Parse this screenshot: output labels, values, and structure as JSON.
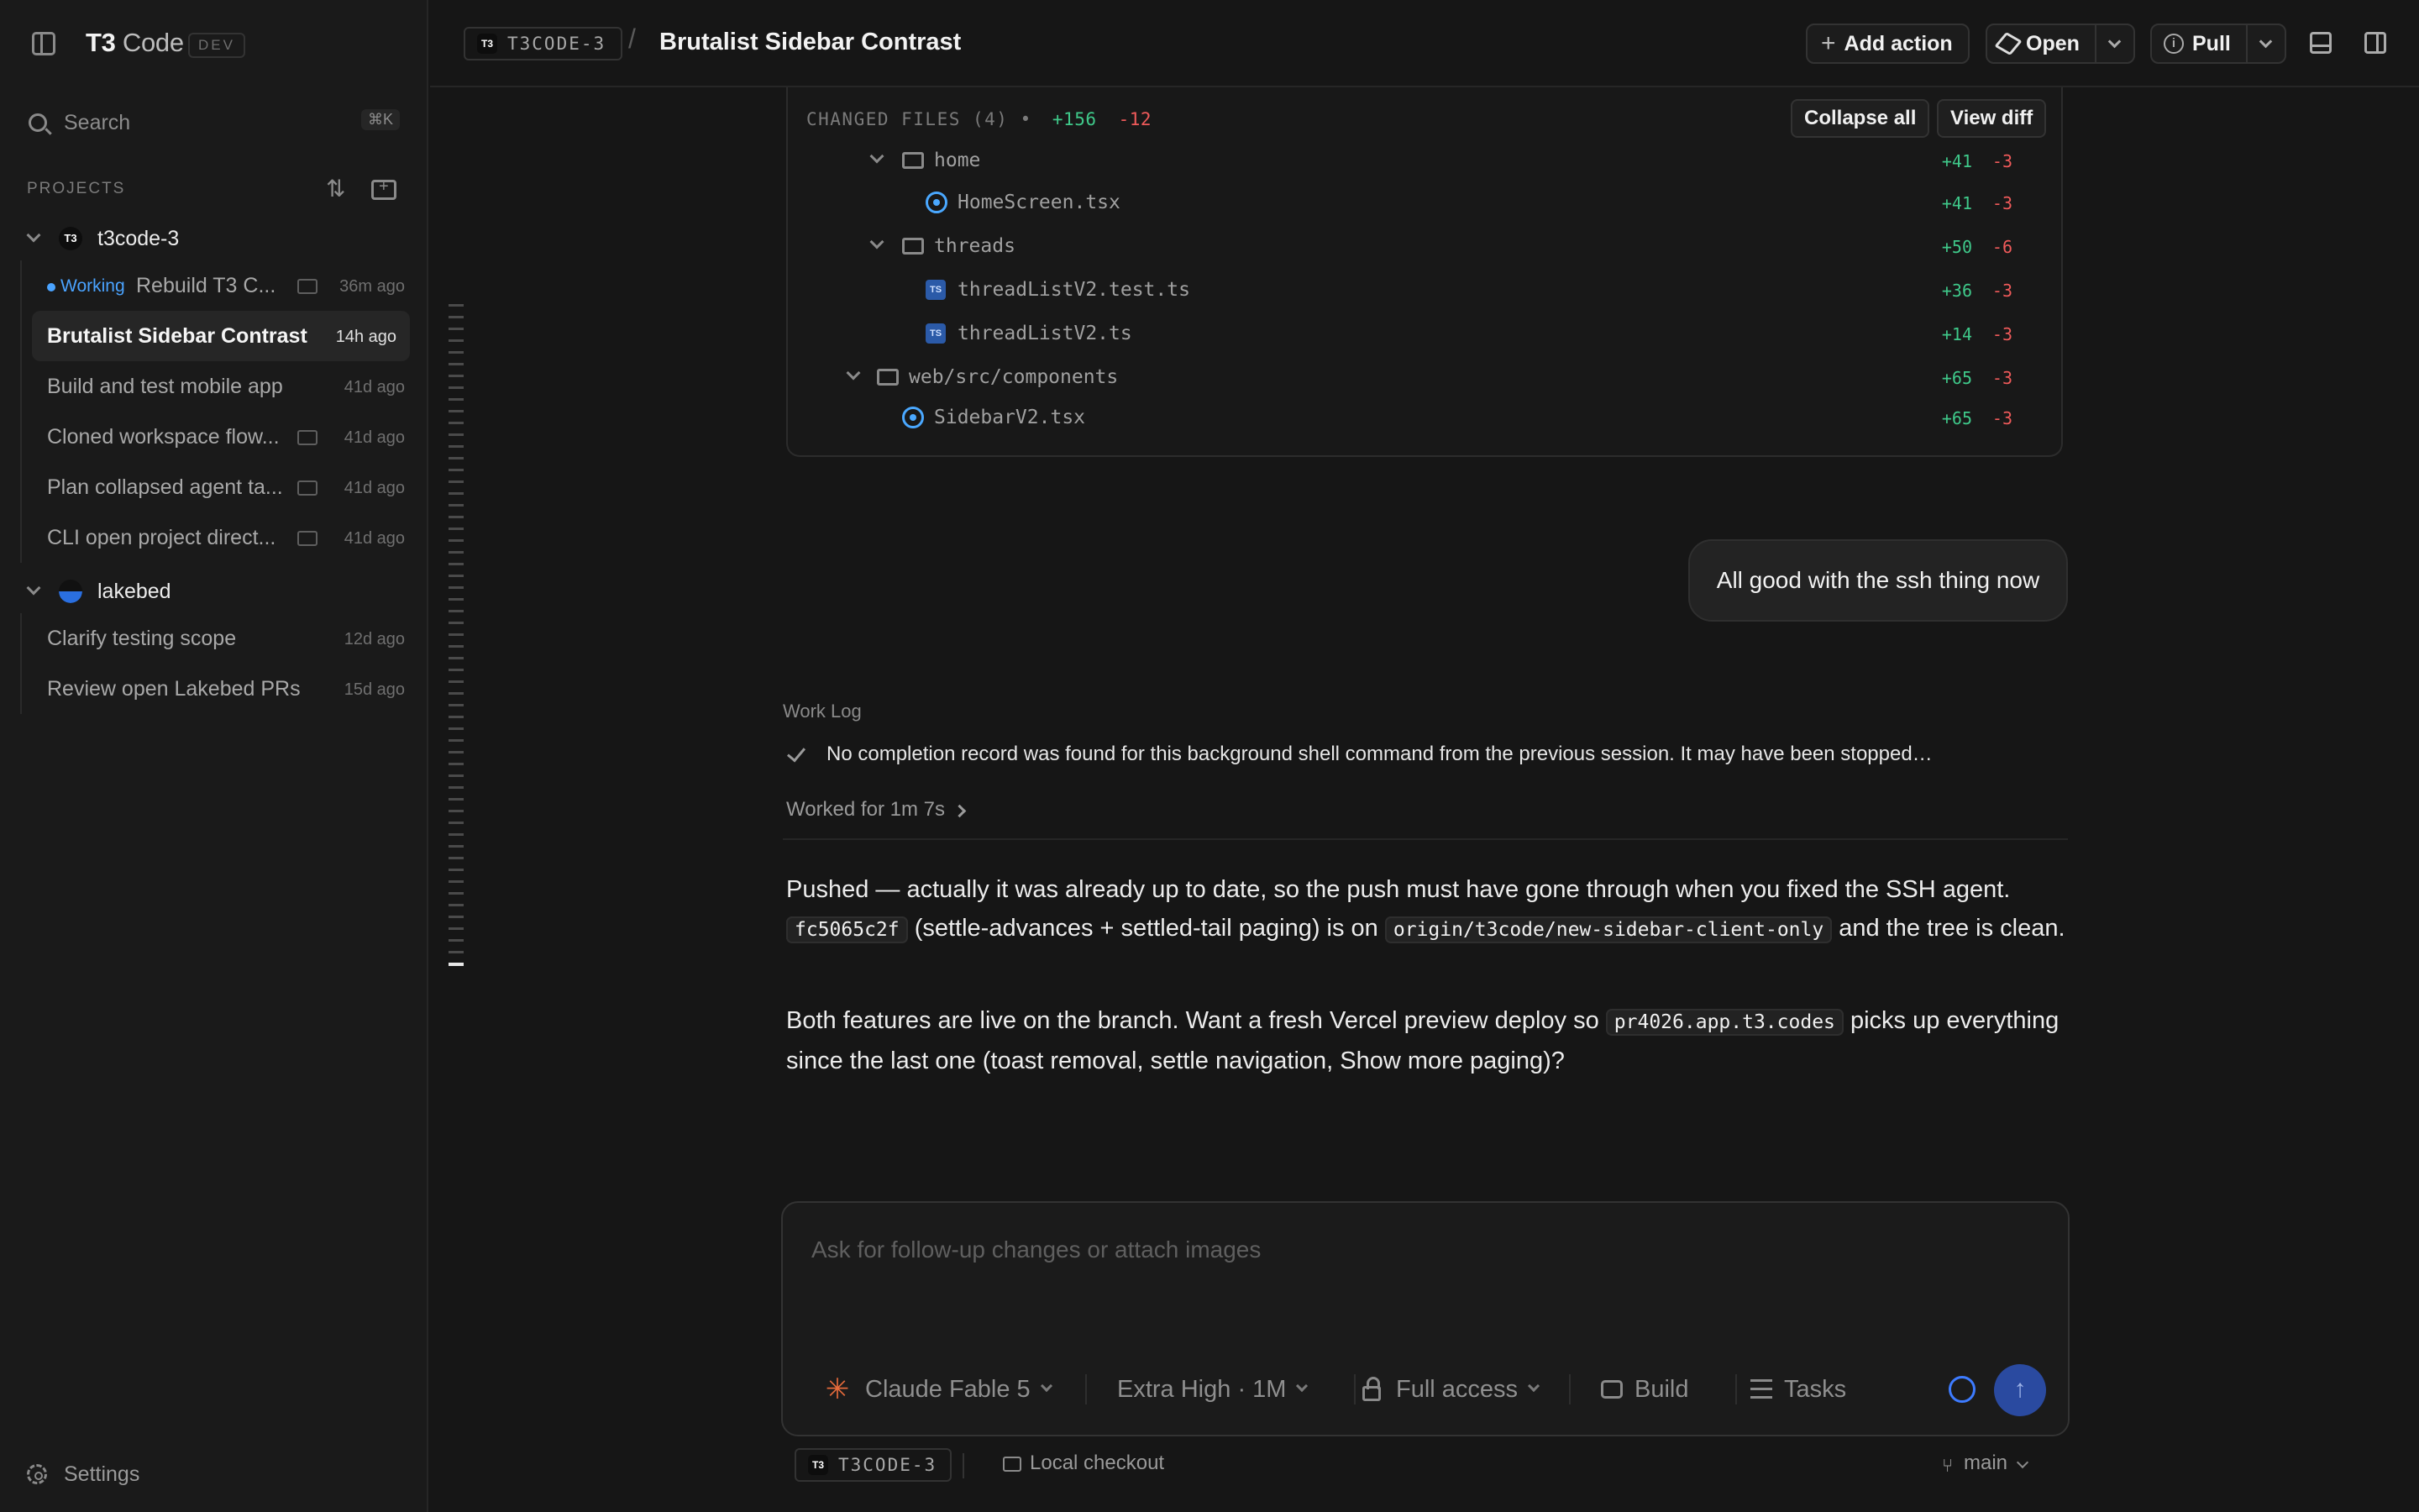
{
  "sidebar": {
    "brand_main": "T3",
    "brand_rest": " Code",
    "dev_badge": "DEV",
    "search_label": "Search",
    "search_shortcut": "⌘K",
    "projects_label": "PROJECTS",
    "projects": [
      {
        "name": "t3code-3",
        "logo": "T3",
        "threads": [
          {
            "status": "Working",
            "title": "Rebuild T3 C...",
            "time": "36m ago"
          },
          {
            "title": "Brutalist Sidebar Contrast",
            "time": "14h ago"
          },
          {
            "title": "Build and test mobile app",
            "time": "41d ago"
          },
          {
            "title": "Cloned workspace flow...",
            "time": "41d ago"
          },
          {
            "title": "Plan collapsed agent ta...",
            "time": "41d ago"
          },
          {
            "title": "CLI open project direct...",
            "time": "41d ago"
          }
        ]
      },
      {
        "name": "lakebed",
        "threads": [
          {
            "title": "Clarify testing scope",
            "time": "12d ago"
          },
          {
            "title": "Review open Lakebed PRs",
            "time": "15d ago"
          }
        ]
      }
    ],
    "settings_label": "Settings"
  },
  "header": {
    "project_tag_logo": "T3",
    "project_tag": "T3CODE-3",
    "separator": "/",
    "title": "Brutalist Sidebar Contrast",
    "add_action": "Add action",
    "open": "Open",
    "pull": "Pull"
  },
  "changed_files": {
    "label": "CHANGED FILES (4)",
    "dot": "•",
    "additions": "+156",
    "deletions": "-12",
    "collapse_all": "Collapse all",
    "view_diff": "View diff",
    "rows": [
      {
        "kind": "folder",
        "name": "home",
        "add": "+41",
        "del": "-3"
      },
      {
        "kind": "react",
        "name": "HomeScreen.tsx",
        "add": "+41",
        "del": "-3"
      },
      {
        "kind": "folder",
        "name": "threads",
        "add": "+50",
        "del": "-6"
      },
      {
        "kind": "ts",
        "name": "threadListV2.test.ts",
        "add": "+36",
        "del": "-3"
      },
      {
        "kind": "ts",
        "name": "threadListV2.ts",
        "add": "+14",
        "del": "-3"
      },
      {
        "kind": "folder",
        "name": "web/src/components",
        "add": "+65",
        "del": "-3"
      },
      {
        "kind": "react",
        "name": "SidebarV2.tsx",
        "add": "+65",
        "del": "-3"
      }
    ],
    "ts_badge": "TS"
  },
  "chat": {
    "user_message": "All good with the ssh thing now",
    "work_log_label": "Work Log",
    "work_log_item": "No completion record was found for this background shell command from the previous session. It may have been stopped…",
    "worked_for": "Worked for 1m 7s",
    "p1_a": "Pushed — actually it was already up to date, so the push must have gone through when you fixed the SSH agent.",
    "p1_code1": "fc5065c2f",
    "p1_b": "(settle-advances + settled-tail paging) is on",
    "p1_code2": "origin/t3code/new-sidebar-client-only",
    "p1_c": "and the tree is clean.",
    "p2_a": "Both features are live on the branch. Want a fresh Vercel preview deploy so",
    "p2_code": "pr4026.app.t3.codes",
    "p2_b": "picks up everything since the last one (toast removal, settle navigation, Show more paging)?"
  },
  "composer": {
    "placeholder": "Ask for follow-up changes or attach images",
    "model": "Claude Fable 5",
    "effort": "Extra High · 1M",
    "access": "Full access",
    "build": "Build",
    "tasks": "Tasks",
    "send_icon": "↑"
  },
  "footer": {
    "project_tag_logo": "T3",
    "project_tag": "T3CODE-3",
    "checkout": "Local checkout",
    "branch": "main"
  },
  "colors": {
    "accent": "#4aa3ff",
    "add": "#3fc98a",
    "del": "#ef5a5a",
    "model_star": "#e46a3b"
  }
}
